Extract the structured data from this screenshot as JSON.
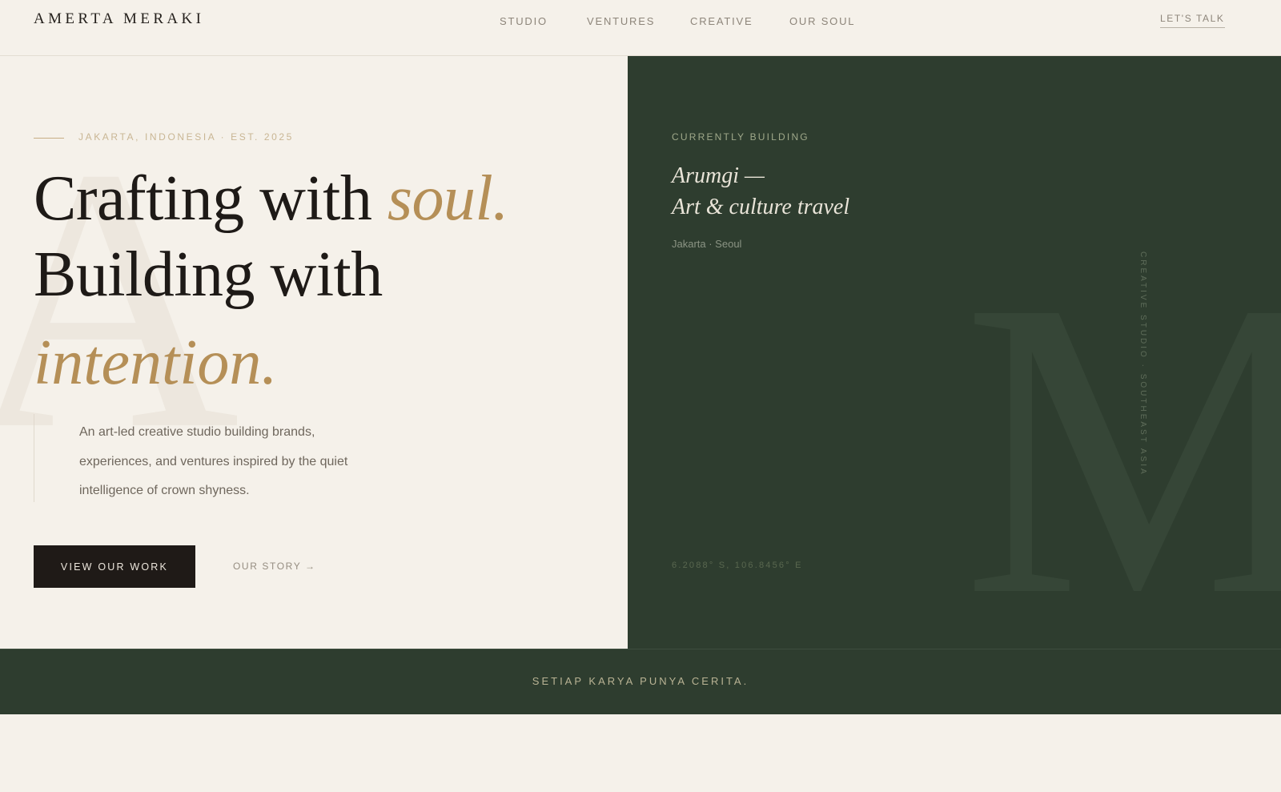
{
  "brand": {
    "name": "AMERTA MERAKI"
  },
  "nav": {
    "items": [
      {
        "label": "STUDIO"
      },
      {
        "label": "VENTURES"
      },
      {
        "label": "CREATIVE"
      },
      {
        "label": "OUR SOUL"
      }
    ],
    "cta": "LET'S TALK"
  },
  "hero": {
    "eyebrow": "JAKARTA, INDONESIA · EST. 2025",
    "headline": {
      "line1_plain": "Crafting with ",
      "line1_accent": "soul.",
      "line2_plain": "Building with",
      "line3_accent": "intention."
    },
    "watermark_letter": "A",
    "description": "An art-led creative studio building brands, experiences, and ventures inspired by the quiet intelligence of crown shyness.",
    "primary_button": "VIEW OUR WORK",
    "secondary_link": "OUR STORY →"
  },
  "panel": {
    "label": "CURRENTLY BUILDING",
    "title_line1": "Arumgi —",
    "title_line2": "Art & culture travel",
    "location": "Jakarta · Seoul",
    "coordinates": "6.2088° S, 106.8456° E",
    "vertical_text": "CREATIVE STUDIO · SOUTHEAST ASIA",
    "watermark_letter": "M"
  },
  "band": {
    "text": "SETIAP KARYA PUNYA CERITA."
  },
  "colors": {
    "cream": "#f5f1ea",
    "forest": "#2e3d2f",
    "gold": "#b58f57",
    "ink": "#1f1a17"
  }
}
